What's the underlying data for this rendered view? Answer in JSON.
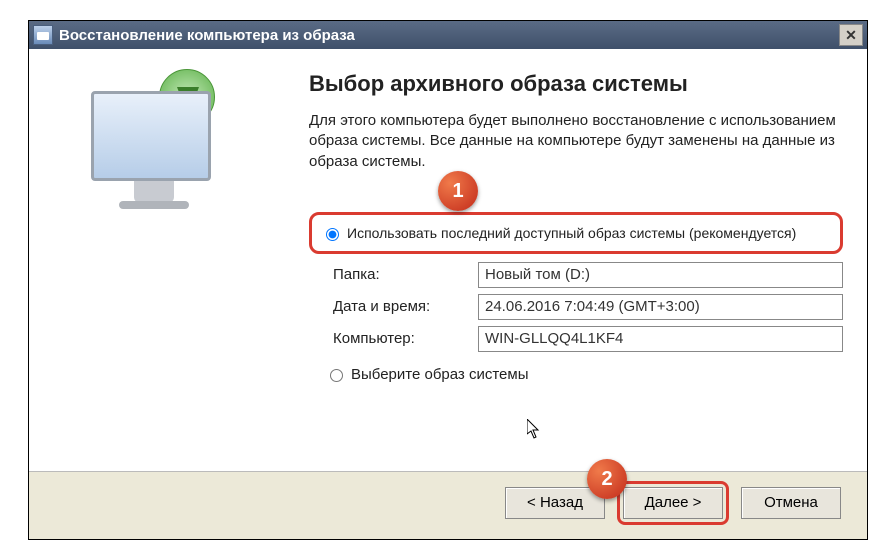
{
  "titlebar": {
    "title": "Восстановление компьютера из образа"
  },
  "heading": "Выбор архивного образа системы",
  "description": "Для этого компьютера будет выполнено восстановление с использованием образа системы. Все данные на компьютере будут заменены на данные из образа системы.",
  "option1": {
    "label": "Использовать последний доступный образ системы (рекомендуется)",
    "checked": true
  },
  "fields": {
    "folder_label": "Папка:",
    "folder_value": "Новый том (D:)",
    "datetime_label": "Дата и время:",
    "datetime_value": "24.06.2016 7:04:49 (GMT+3:00)",
    "computer_label": "Компьютер:",
    "computer_value": "WIN-GLLQQ4L1KF4"
  },
  "option2": {
    "label": "Выберите образ системы",
    "checked": false
  },
  "buttons": {
    "back": "< Назад",
    "next": "Далее >",
    "cancel": "Отмена"
  },
  "annotations": {
    "badge1": "1",
    "badge2": "2"
  }
}
